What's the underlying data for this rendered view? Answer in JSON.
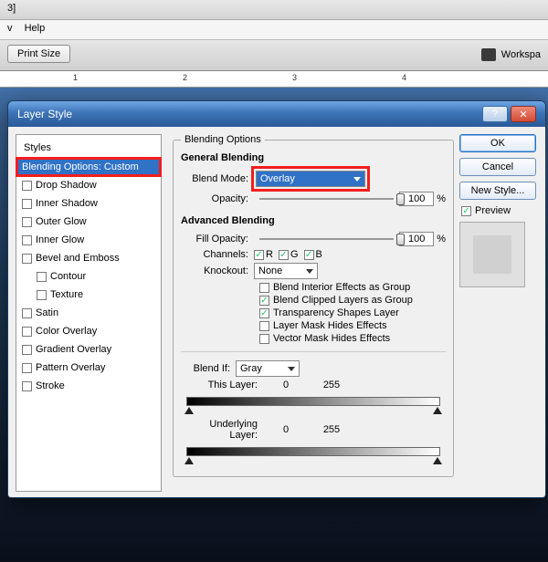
{
  "titlebar_fragment": "3]",
  "menubar": {
    "items": [
      "v",
      "Help"
    ]
  },
  "toolbar": {
    "printSize": "Print Size",
    "workspace": "Workspa"
  },
  "ruler": {
    "marks": [
      "1",
      "2",
      "3",
      "4"
    ]
  },
  "dialog": {
    "title": "Layer Style",
    "close_glyph": "✕",
    "help_glyph": "?",
    "sidebar": {
      "heading": "Styles",
      "selected": "Blending Options: Custom",
      "items": [
        "Drop Shadow",
        "Inner Shadow",
        "Outer Glow",
        "Inner Glow",
        "Bevel and Emboss",
        "Contour",
        "Texture",
        "Satin",
        "Color Overlay",
        "Gradient Overlay",
        "Pattern Overlay",
        "Stroke"
      ]
    },
    "blending": {
      "heading": "Blending Options",
      "general": {
        "legend": "General Blending",
        "blendModeLabel": "Blend Mode:",
        "blendMode": "Overlay",
        "opacityLabel": "Opacity:",
        "opacity": "100",
        "pct": "%"
      },
      "advanced": {
        "legend": "Advanced Blending",
        "fillOpacityLabel": "Fill Opacity:",
        "fillOpacity": "100",
        "pct": "%",
        "channelsLabel": "Channels:",
        "channels": [
          "R",
          "G",
          "B"
        ],
        "knockoutLabel": "Knockout:",
        "knockout": "None",
        "checks": [
          {
            "label": "Blend Interior Effects as Group",
            "on": false
          },
          {
            "label": "Blend Clipped Layers as Group",
            "on": true
          },
          {
            "label": "Transparency Shapes Layer",
            "on": true
          },
          {
            "label": "Layer Mask Hides Effects",
            "on": false
          },
          {
            "label": "Vector Mask Hides Effects",
            "on": false
          }
        ]
      },
      "blendif": {
        "label": "Blend If:",
        "mode": "Gray",
        "thisLayer": "This Layer:",
        "underlying": "Underlying Layer:",
        "range": [
          "0",
          "255"
        ]
      }
    },
    "actions": {
      "ok": "OK",
      "cancel": "Cancel",
      "newStyle": "New Style...",
      "preview": "Preview"
    }
  }
}
